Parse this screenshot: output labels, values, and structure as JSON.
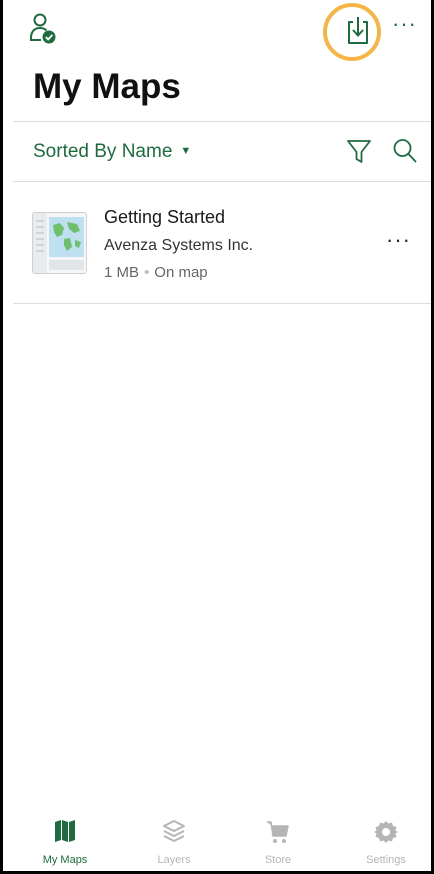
{
  "header": {
    "title": "My Maps",
    "account_icon": "account-verified-icon",
    "download_icon": "download-icon",
    "more_label": "···",
    "highlight_color": "#f4b54a"
  },
  "toolbar": {
    "sort_label": "Sorted By Name",
    "sort_caret": "▼",
    "filter_icon": "filter-icon",
    "search_icon": "search-icon"
  },
  "maps": [
    {
      "title": "Getting Started",
      "author": "Avenza Systems Inc.",
      "size": "1 MB",
      "status": "On map",
      "separator": "•",
      "more_label": "···"
    }
  ],
  "tabbar": {
    "tabs": [
      {
        "label": "My Maps",
        "icon": "map-icon",
        "active": true
      },
      {
        "label": "Layers",
        "icon": "layers-icon",
        "active": false
      },
      {
        "label": "Store",
        "icon": "cart-icon",
        "active": false
      },
      {
        "label": "Settings",
        "icon": "gear-icon",
        "active": false
      }
    ]
  },
  "colors": {
    "accent": "#1f6b3f",
    "inactive": "#b5b5b5"
  }
}
